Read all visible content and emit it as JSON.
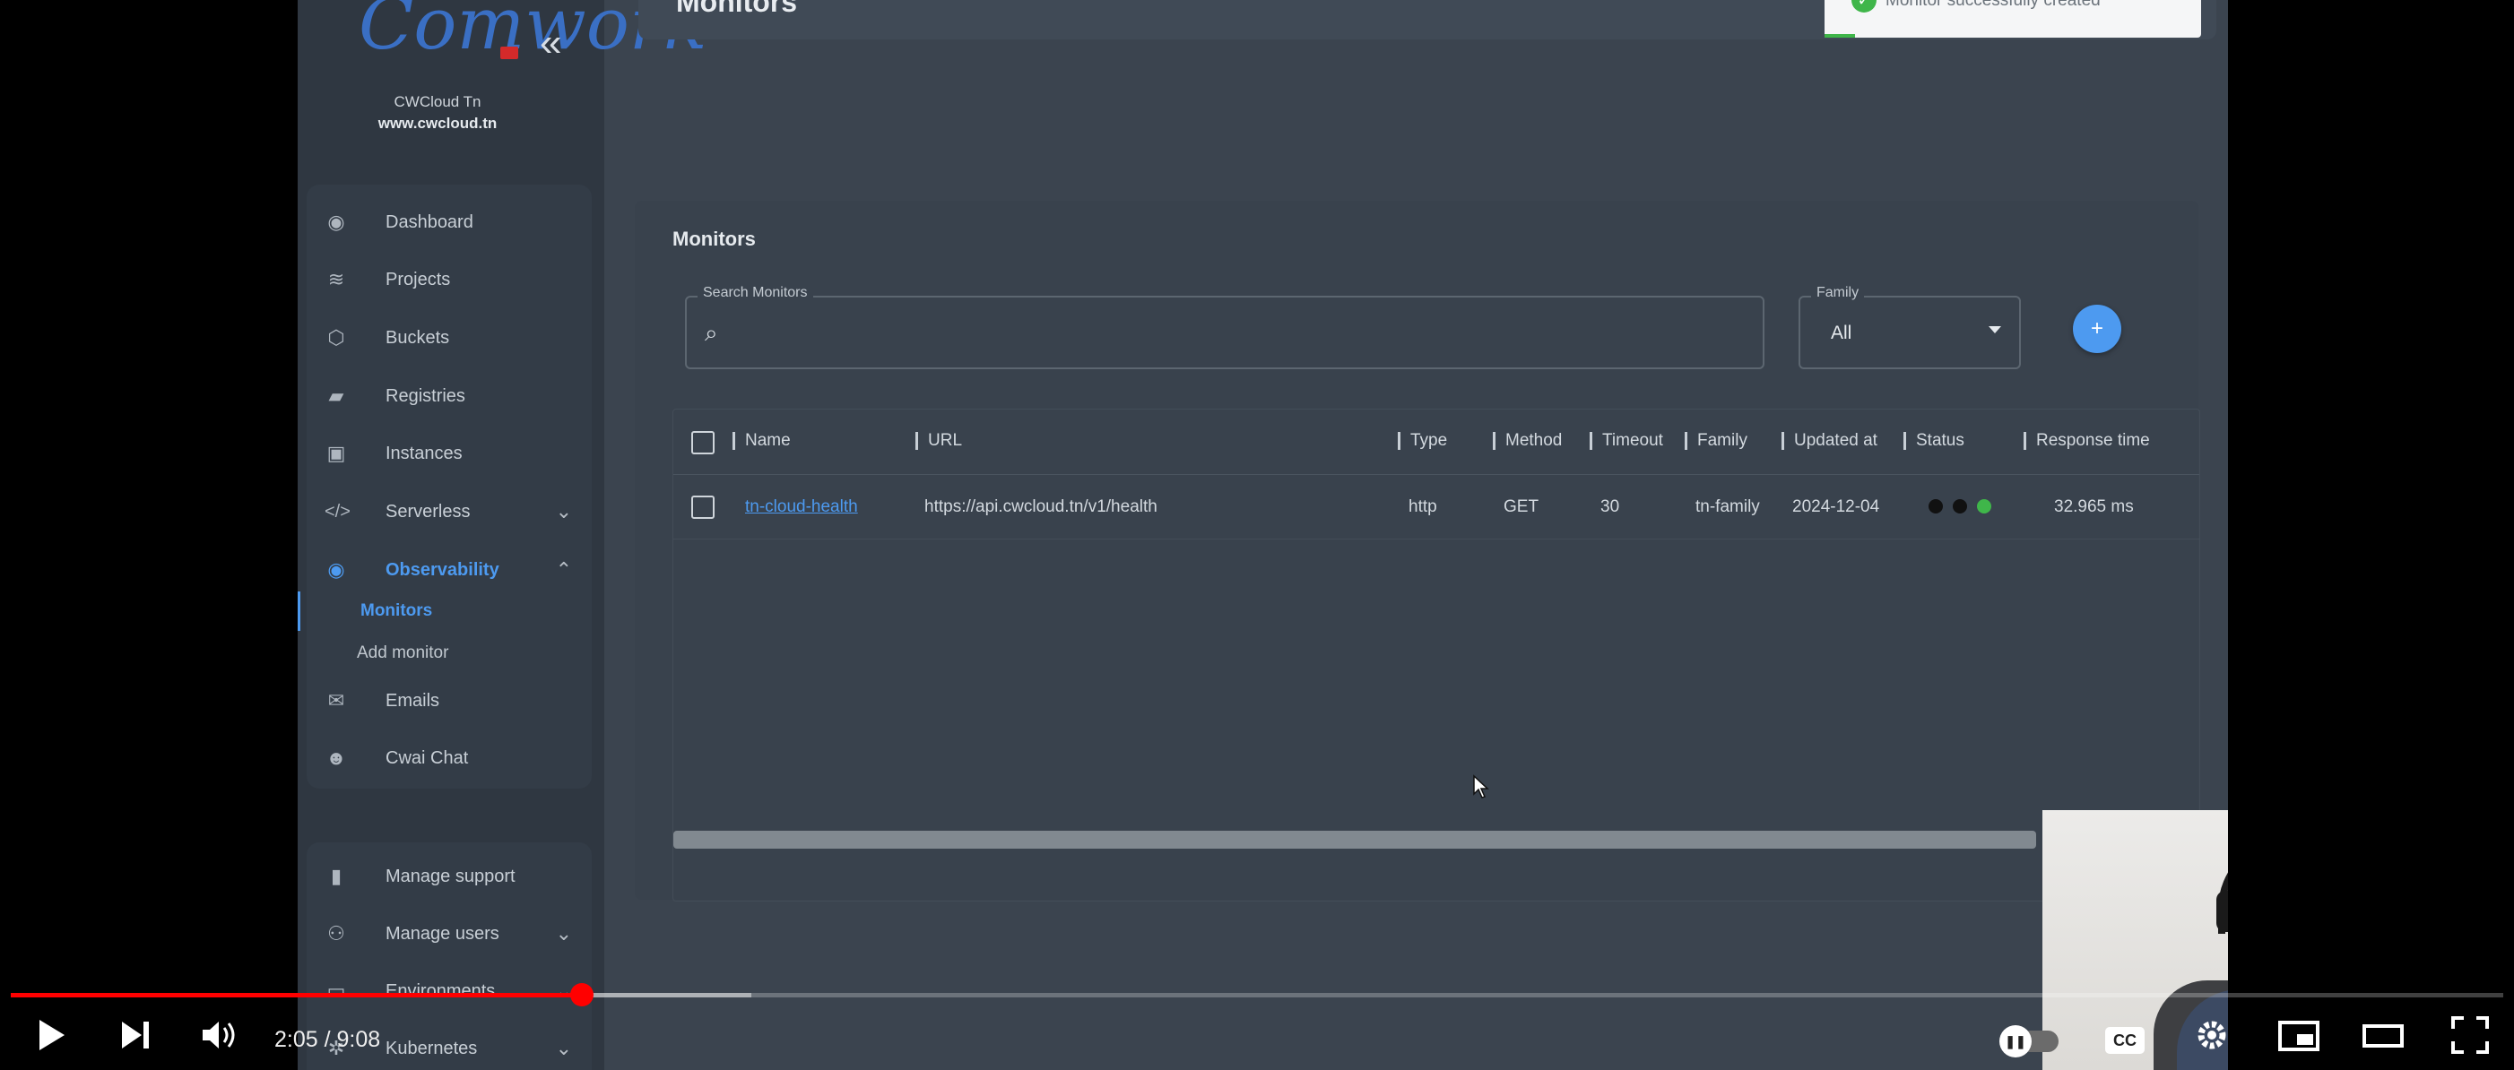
{
  "app": {
    "brand_name": "CWCloud Tn",
    "brand_url": "www.cwcloud.tn",
    "logo_text": "Comwork",
    "page_title": "Monitors"
  },
  "toast": {
    "message": "Monitor successfully created"
  },
  "sidebar": {
    "items": [
      {
        "label": "Dashboard",
        "icon": "dashboard-icon"
      },
      {
        "label": "Projects",
        "icon": "layers-icon"
      },
      {
        "label": "Buckets",
        "icon": "bucket-icon"
      },
      {
        "label": "Registries",
        "icon": "docker-icon"
      },
      {
        "label": "Instances",
        "icon": "chip-icon"
      },
      {
        "label": "Serverless",
        "icon": "code-icon"
      },
      {
        "label": "Observability",
        "icon": "eye-icon"
      },
      {
        "label": "Emails",
        "icon": "mail-icon"
      },
      {
        "label": "Cwai Chat",
        "icon": "robot-icon"
      }
    ],
    "sub_items": [
      {
        "label": "Monitors"
      },
      {
        "label": "Add monitor"
      }
    ],
    "admin_items": [
      {
        "label": "Manage support",
        "icon": "chat-icon"
      },
      {
        "label": "Manage users",
        "icon": "users-icon"
      },
      {
        "label": "Environments",
        "icon": "environment-icon"
      },
      {
        "label": "Kubernetes",
        "icon": "kubernetes-icon"
      }
    ]
  },
  "monitors": {
    "card_title": "Monitors",
    "search_label": "Search Monitors",
    "search_value": "",
    "family_label": "Family",
    "family_value": "All",
    "add_label": "+",
    "columns": [
      "Name",
      "URL",
      "Type",
      "Method",
      "Timeout",
      "Family",
      "Updated at",
      "Status",
      "Response time"
    ],
    "rows": [
      {
        "name": "tn-cloud-health",
        "url": "https://api.cwcloud.tn/v1/health",
        "type": "http",
        "method": "GET",
        "timeout": "30",
        "family": "tn-family",
        "updated_at": "2024-12-04",
        "status_colors": [
          "#111111",
          "#111111",
          "#3fb64a"
        ],
        "response_time": "32.965 ms"
      }
    ]
  },
  "player": {
    "time": "2:05 / 9:08",
    "progress_fraction": 0.229,
    "buffered_fraction": 0.297,
    "cc_label": "CC"
  },
  "colors": {
    "accent": "#4d9af0",
    "progress": "#ff0000",
    "success": "#3fb64a"
  }
}
